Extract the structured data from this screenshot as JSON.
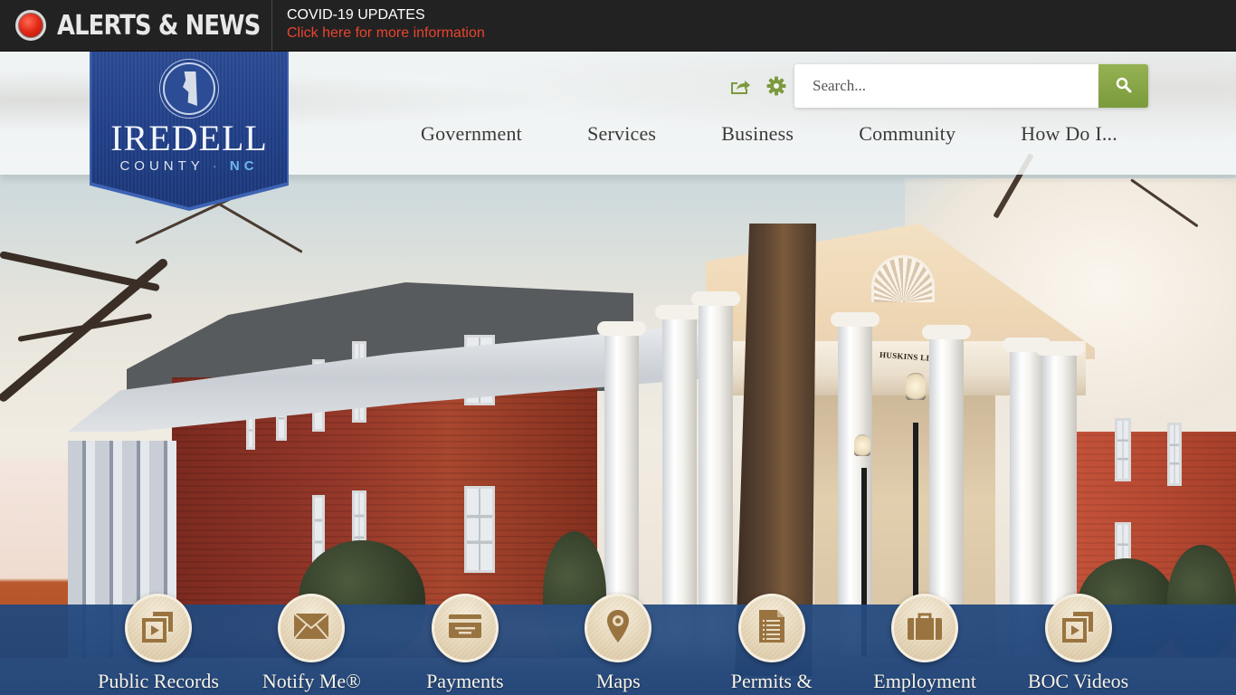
{
  "alerts": {
    "title": "ALERTS & NEWS",
    "icon": "alert-red-dot-icon",
    "headline": "COVID-19 UPDATES",
    "link_text": "Click here for more information"
  },
  "logo": {
    "name": "IREDELL",
    "county": "COUNTY",
    "separator": "·",
    "state": "NC"
  },
  "utility": {
    "share_icon": "share-icon",
    "settings_icon": "gear-icon"
  },
  "search": {
    "placeholder": "Search...",
    "value": "",
    "button_icon": "search-icon"
  },
  "nav": {
    "items": [
      {
        "label": "Government"
      },
      {
        "label": "Services"
      },
      {
        "label": "Business"
      },
      {
        "label": "Community"
      },
      {
        "label": "How Do I..."
      }
    ]
  },
  "hero": {
    "sign_text": "HUSKINS LIBRARY"
  },
  "quick_links": [
    {
      "label": "Public Records",
      "icon": "media-play-icon"
    },
    {
      "label": "Notify Me®",
      "icon": "envelope-icon"
    },
    {
      "label": "Payments",
      "icon": "credit-card-icon"
    },
    {
      "label": "Maps",
      "icon": "map-pin-icon"
    },
    {
      "label": "Permits &",
      "icon": "document-list-icon"
    },
    {
      "label": "Employment",
      "icon": "briefcase-icon"
    },
    {
      "label": "BOC Videos",
      "icon": "media-play-icon"
    }
  ],
  "colors": {
    "alert_bar": "#222222",
    "alert_link": "#e8442e",
    "logo_blue": "#1f3e86",
    "accent_green": "#7a9a3c",
    "quick_bar_blue": "#22487e",
    "quick_icon_gold": "#9a7440"
  }
}
